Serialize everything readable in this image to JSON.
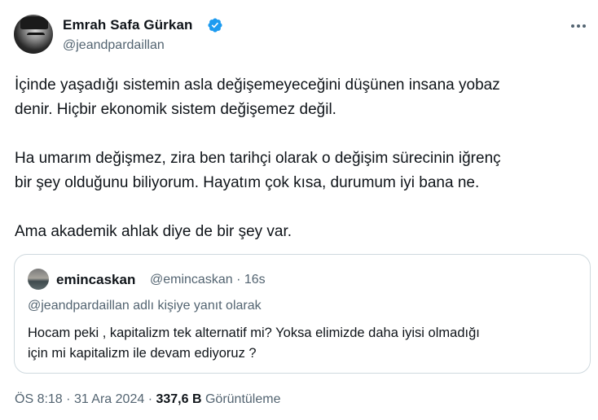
{
  "author": {
    "name": "Emrah Safa Gürkan",
    "handle": "@jeandpardaillan",
    "verified": true
  },
  "tweet": {
    "paragraphs": [
      [
        "İçinde yaşadığı sistemin asla değişemeyeceğini düşünen insana yobaz",
        "denir. Hiçbir ekonomik sistem değişemez değil."
      ],
      [
        "Ha umarım değişmez, zira ben tarihçi olarak o değişim sürecinin iğrenç",
        "bir şey olduğunu biliyorum. Hayatım çok kısa, durumum iyi bana ne."
      ],
      [
        "Ama akademik ahlak diye de bir şey var."
      ]
    ]
  },
  "quoted": {
    "name": "emincaskan",
    "handle": "@emincaskan",
    "separator": "·",
    "time": "16s",
    "reply_to": "@jeandpardaillan adlı kişiye yanıt olarak",
    "lines": [
      "Hocam peki , kapitalizm tek alternatif mi? Yoksa elimizde daha iyisi olmadığı",
      "için mi kapitalizm ile devam ediyoruz ?"
    ]
  },
  "footer": {
    "time": "ÖS 8:18",
    "dot1": "·",
    "date": "31 Ara 2024",
    "dot2": "·",
    "views_count": "337,6 B",
    "views_label": "Görüntüleme"
  },
  "colors": {
    "text": "#0f1419",
    "secondary": "#536471",
    "verified_blue": "#1d9bf0",
    "border": "#cfd9de"
  },
  "icons": {
    "verified": "verified-badge-icon",
    "more": "more-horizontal-icon"
  }
}
